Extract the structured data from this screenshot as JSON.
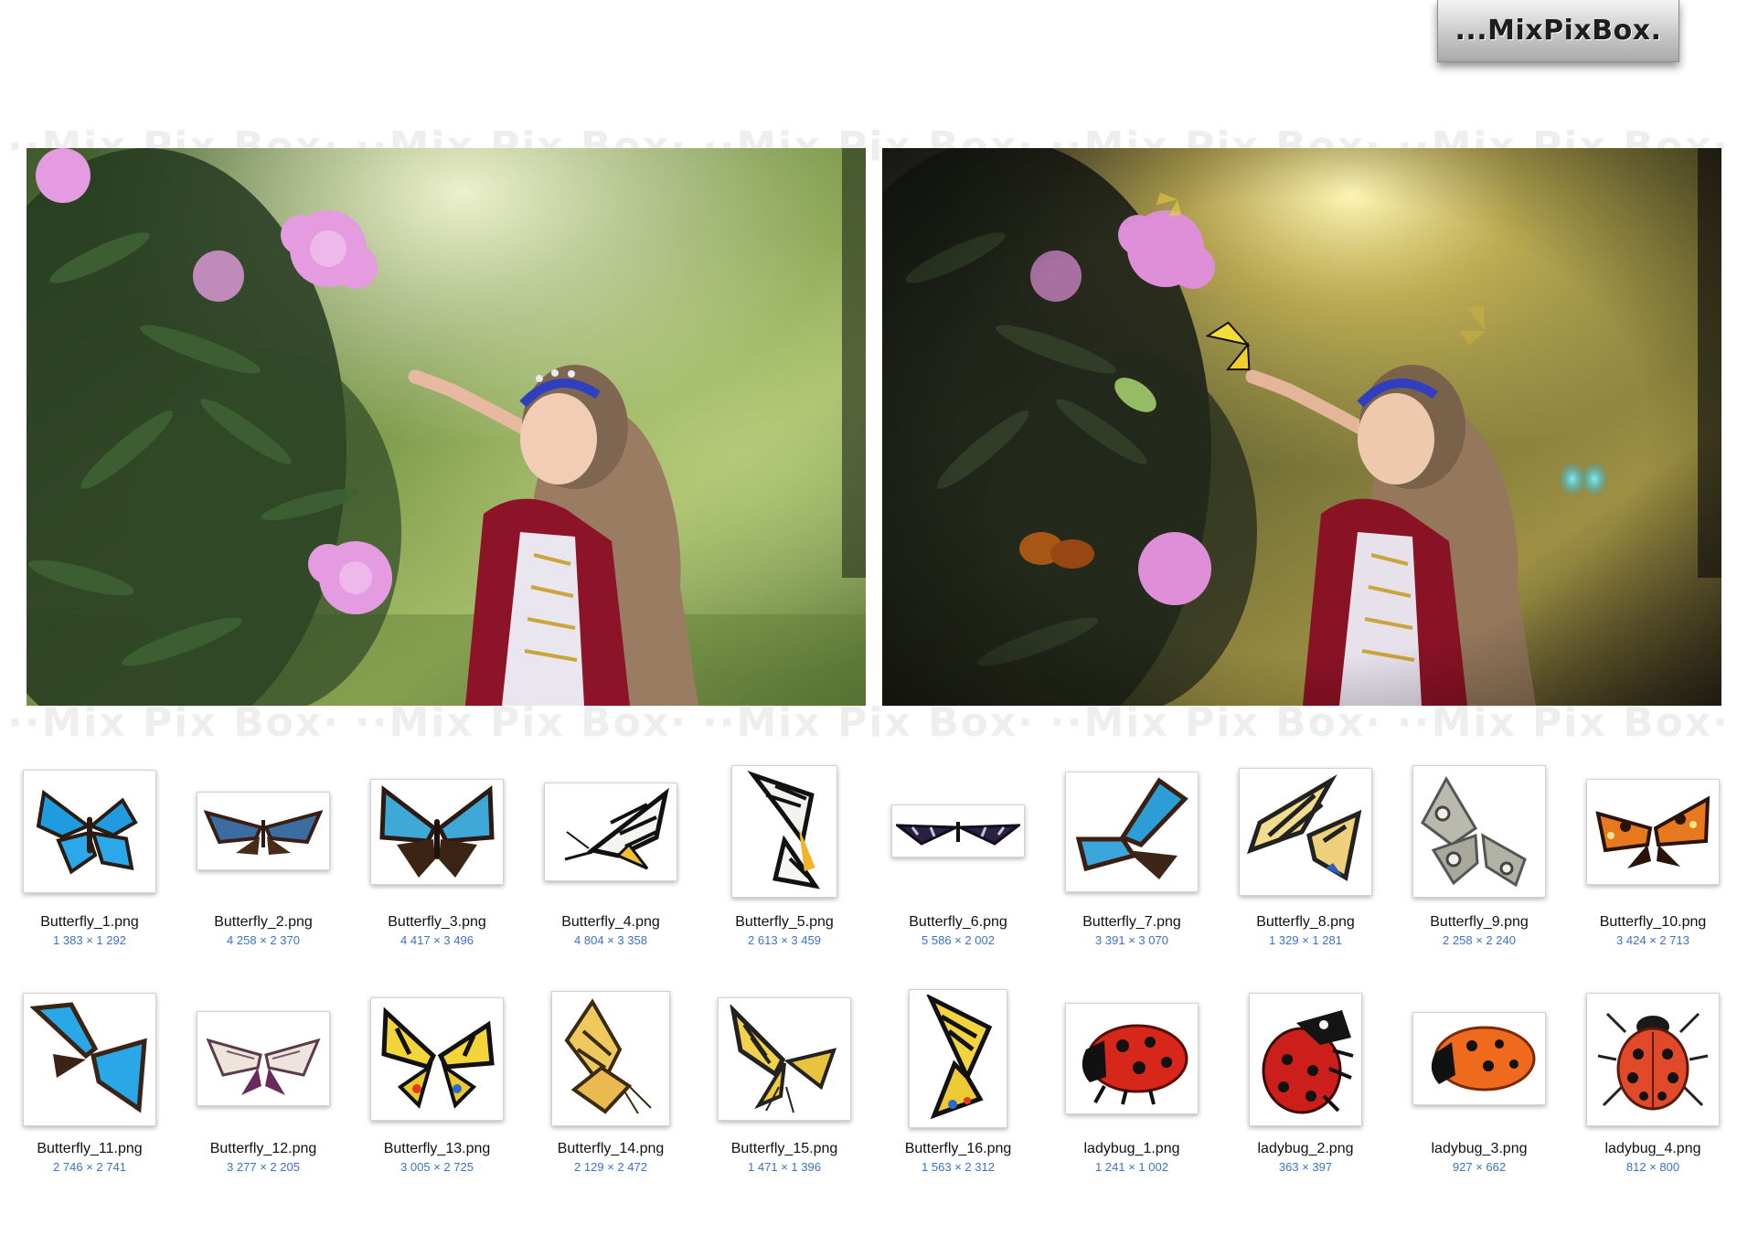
{
  "logo": {
    "text": "...MixPixBox."
  },
  "watermark": {
    "text": "··Mix Pix Box·"
  },
  "preview": {
    "before_label": "",
    "after_label": ""
  },
  "colors": {
    "accent_dims": "#3a72c8",
    "morpho_blue": "#1f9be0",
    "swallowtail_yellow": "#f3d53a",
    "ladybug_red": "#d7261a",
    "ladybug_orange": "#f06a1e"
  },
  "files": {
    "row1": [
      {
        "name": "Butterfly_1.png",
        "dims": "1 383 × 1 292",
        "kind": "morpho"
      },
      {
        "name": "Butterfly_2.png",
        "dims": "4 258 × 2 370",
        "kind": "morpho-spread"
      },
      {
        "name": "Butterfly_3.png",
        "dims": "4 417 × 3 496",
        "kind": "morpho-dark"
      },
      {
        "name": "Butterfly_4.png",
        "dims": "4 804 × 3 358",
        "kind": "monarch-side"
      },
      {
        "name": "Butterfly_5.png",
        "dims": "2 613 × 3 459",
        "kind": "monarch-vertical"
      },
      {
        "name": "Butterfly_6.png",
        "dims": "5 586 × 2 002",
        "kind": "dark-spread"
      },
      {
        "name": "Butterfly_7.png",
        "dims": "3 391 × 3 070",
        "kind": "morpho-tilt"
      },
      {
        "name": "Butterfly_8.png",
        "dims": "1 329 × 1 281",
        "kind": "tiger-swallowtail"
      },
      {
        "name": "Butterfly_9.png",
        "dims": "2 258 × 2 240",
        "kind": "gray-pansy"
      },
      {
        "name": "Butterfly_10.png",
        "dims": "3 424 × 2 713",
        "kind": "tortoiseshell"
      }
    ],
    "row2": [
      {
        "name": "Butterfly_11.png",
        "dims": "2 746 × 2 741",
        "kind": "morpho-tilt"
      },
      {
        "name": "Butterfly_12.png",
        "dims": "3 277 × 2 205",
        "kind": "mauve-spread"
      },
      {
        "name": "Butterfly_13.png",
        "dims": "3 005 × 2 725",
        "kind": "swallowtail"
      },
      {
        "name": "Butterfly_14.png",
        "dims": "2 129 × 2 472",
        "kind": "yellow-side"
      },
      {
        "name": "Butterfly_15.png",
        "dims": "1 471 × 1 396",
        "kind": "swallowtail-side"
      },
      {
        "name": "Butterfly_16.png",
        "dims": "1 563 × 2 312",
        "kind": "swallowtail-vertical"
      },
      {
        "name": "ladybug_1.png",
        "dims": "1 241 × 1 002",
        "kind": "ladybug-side"
      },
      {
        "name": "ladybug_2.png",
        "dims": "363 × 397",
        "kind": "ladybug-front"
      },
      {
        "name": "ladybug_3.png",
        "dims": "927 × 662",
        "kind": "ladybug-orange"
      },
      {
        "name": "ladybug_4.png",
        "dims": "812 × 800",
        "kind": "ladybug-top"
      }
    ]
  }
}
